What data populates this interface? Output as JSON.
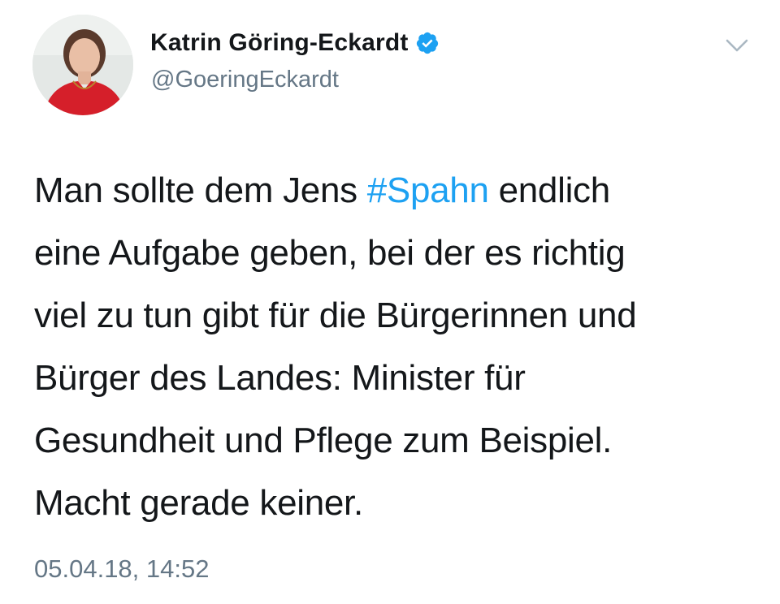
{
  "author": {
    "display_name": "Katrin Göring-Eckardt",
    "handle": "@GoeringEckardt",
    "verified": true,
    "avatar_icon": "profile-photo"
  },
  "icons": {
    "verified": "verified-badge-icon",
    "menu": "chevron-down-icon"
  },
  "tweet": {
    "lines": [
      {
        "before": "Man sollte dem Jens ",
        "hashtag": "#Spahn",
        "after": " endlich"
      },
      {
        "text": "eine Aufgabe geben, bei der es richtig"
      },
      {
        "text": "viel zu tun gibt für die Bürgerinnen und"
      },
      {
        "text": "Bürger des Landes: Minister für"
      },
      {
        "text": "Gesundheit und Pflege zum Beispiel."
      },
      {
        "text": "Macht gerade keiner."
      }
    ],
    "timestamp": "05.04.18, 14:52"
  },
  "colors": {
    "link": "#1da1f2",
    "secondary_text": "#657786",
    "primary_text": "#14171a"
  }
}
